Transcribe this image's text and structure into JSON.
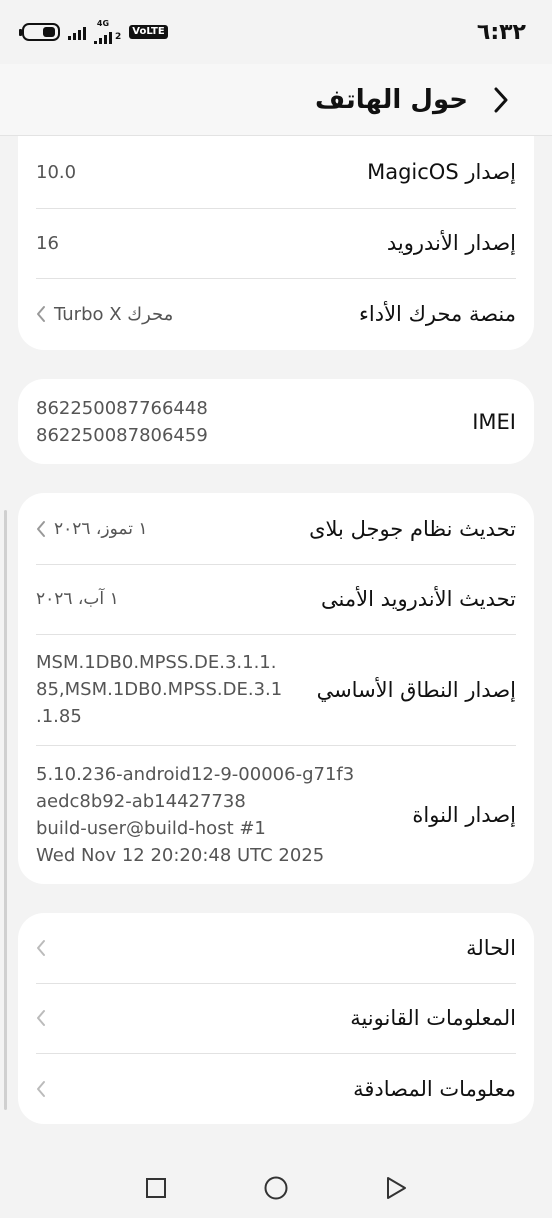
{
  "status_bar": {
    "time": "٦:٣٢",
    "network_type": "4G",
    "sim_slot": "2",
    "volte": "VoLTE"
  },
  "header": {
    "title": "حول الهاتف"
  },
  "card_software": {
    "rows": [
      {
        "label": "إصدار MagicOS",
        "value": "10.0"
      },
      {
        "label": "إصدار الأندرويد",
        "value": "16"
      },
      {
        "label": "منصة محرك الأداء",
        "value": "محرك Turbo X"
      }
    ]
  },
  "card_imei": {
    "label": "IMEI",
    "values": [
      "862250087766448",
      "862250087806459"
    ]
  },
  "card_updates": {
    "rows": [
      {
        "label": "تحديث نظام جوجل بلاى",
        "value": "١ تموز، ٢٠٢٦"
      },
      {
        "label": "تحديث الأندرويد الأمنى",
        "value": "١ آب، ٢٠٢٦"
      },
      {
        "label": "إصدار النطاق الأساسي",
        "value_lines": [
          "MSM.1DB0.MPSS.DE.3.1.1.",
          "85,MSM.1DB0.MPSS.DE.3.1",
          ".1.85"
        ]
      },
      {
        "label": "إصدار النواة",
        "value_lines": [
          "5.10.236-android12-9-00006-g71f3",
          "aedc8b92-ab14427738",
          "build-user@build-host #1",
          "Wed Nov 12 20:20:48 UTC 2025"
        ]
      }
    ]
  },
  "card_links": {
    "rows": [
      {
        "label": "الحالة"
      },
      {
        "label": "المعلومات القانونية"
      },
      {
        "label": "معلومات المصادقة"
      }
    ]
  }
}
